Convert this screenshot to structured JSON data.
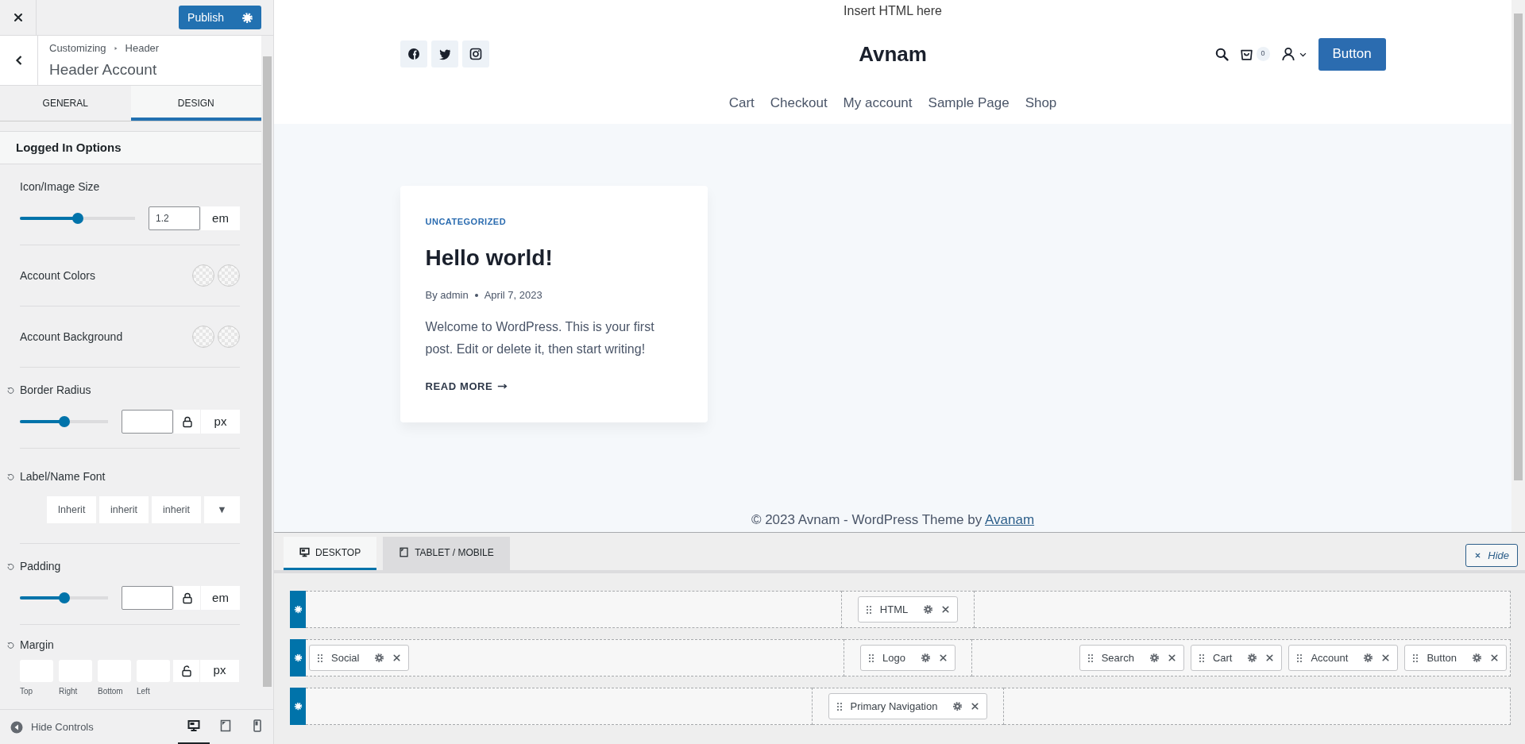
{
  "sidebar": {
    "publish": "Publish",
    "breadcrumb": [
      "Customizing",
      "Header"
    ],
    "title": "Header Account",
    "tabs": [
      {
        "label": "GENERAL",
        "selected": false
      },
      {
        "label": "DESIGN",
        "selected": true
      }
    ],
    "section": "Logged In Options",
    "controls": [
      {
        "kind": "slider",
        "label": "Icon/Image Size",
        "level": 0.5,
        "value": "1.2",
        "unit": "em"
      },
      {
        "kind": "colors",
        "label": "Account Colors"
      },
      {
        "kind": "colors",
        "label": "Account Background"
      },
      {
        "kind": "slider",
        "label": "Border Radius",
        "reset": true,
        "level": 0.5,
        "linked": true,
        "unit": "px"
      },
      {
        "kind": "font",
        "label": "Label/Name Font",
        "reset": true,
        "options": [
          "Inherit",
          "inherit",
          "inherit",
          "▼"
        ]
      },
      {
        "kind": "slider",
        "label": "Padding",
        "reset": true,
        "level": 0.5,
        "linked": true,
        "unit": "em"
      },
      {
        "kind": "sides",
        "label": "Margin",
        "reset": true,
        "sides": [
          "Top",
          "Right",
          "Bottom",
          "Left"
        ],
        "linked": false,
        "unit": "px"
      }
    ],
    "hide_controls": "Hide Controls",
    "devices": [
      {
        "kind": "desktop",
        "selected": true
      },
      {
        "kind": "tablet",
        "selected": false
      },
      {
        "kind": "phone",
        "selected": false
      }
    ]
  },
  "preview": {
    "top_html": "Insert HTML here",
    "social": [
      {
        "kind": "facebook"
      },
      {
        "kind": "twitter"
      },
      {
        "kind": "instagram"
      }
    ],
    "logo": "Avnam",
    "cart_count": "0",
    "button": "Button",
    "nav": [
      "Cart",
      "Checkout",
      "My account",
      "Sample Page",
      "Shop"
    ],
    "post": {
      "category": "UNCATEGORIZED",
      "title": "Hello world!",
      "author": "By admin",
      "date": "April 7, 2023",
      "excerpt": "Welcome to WordPress. This is your first post. Edit or delete it, then start writing!",
      "read_more": "READ MORE"
    },
    "footer": {
      "text": "© 2023 Avnam - WordPress Theme by",
      "link": "Avanam"
    }
  },
  "builder": {
    "tabs": [
      {
        "kind": "desktop",
        "label": "DESKTOP",
        "selected": true
      },
      {
        "kind": "tablet",
        "label": "TABLET / MOBILE",
        "selected": false
      }
    ],
    "hide": "Hide",
    "rows": [
      {
        "center": [
          "HTML"
        ]
      },
      {
        "left": [
          "Social"
        ],
        "center": [
          "Logo"
        ],
        "right": [
          "Search",
          "Cart",
          "Account",
          "Button"
        ]
      },
      {
        "center": [
          "Primary Navigation"
        ]
      }
    ]
  }
}
